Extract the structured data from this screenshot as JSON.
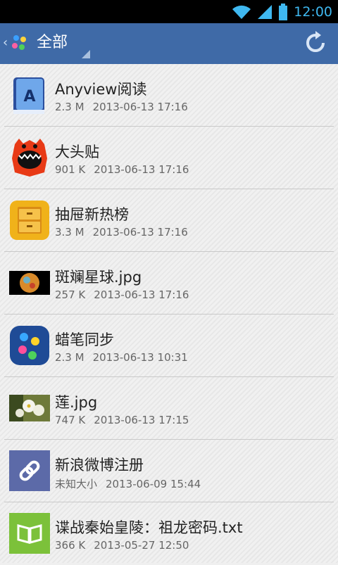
{
  "status_bar": {
    "time": "12:00",
    "icons": [
      "wifi-icon",
      "signal-icon",
      "battery-icon"
    ]
  },
  "action_bar": {
    "title": "全部",
    "icons": [
      "app-logo-icon",
      "refresh-icon"
    ]
  },
  "files": [
    {
      "name": "Anyview阅读",
      "size": "2.3 M",
      "date": "2013-06-13 17:16",
      "icon": "anyview-book-icon"
    },
    {
      "name": "大头贴",
      "size": "901 K",
      "date": "2013-06-13 17:16",
      "icon": "red-monster-icon"
    },
    {
      "name": "抽屉新热榜",
      "size": "3.3 M",
      "date": "2013-06-13 17:16",
      "icon": "drawer-icon"
    },
    {
      "name": "斑斓星球.jpg",
      "size": "257 K",
      "date": "2013-06-13 17:16",
      "icon": "planet-thumbnail"
    },
    {
      "name": "蜡笔同步",
      "size": "2.3 M",
      "date": "2013-06-13 10:31",
      "icon": "crayon-sync-icon"
    },
    {
      "name": "莲.jpg",
      "size": "747 K",
      "date": "2013-06-13 17:15",
      "icon": "flower-thumbnail"
    },
    {
      "name": "新浪微博注册",
      "size": "未知大小",
      "date": "2013-06-09 15:44",
      "icon": "link-icon"
    },
    {
      "name": "谍战秦始皇陵：祖龙密码.txt",
      "size": "366 K",
      "date": "2013-05-27 12:50",
      "icon": "open-book-icon"
    }
  ],
  "colors": {
    "action_bar": "#3f6aa7",
    "status_time": "#3fb8f0",
    "divider": "#c9c9c9"
  }
}
